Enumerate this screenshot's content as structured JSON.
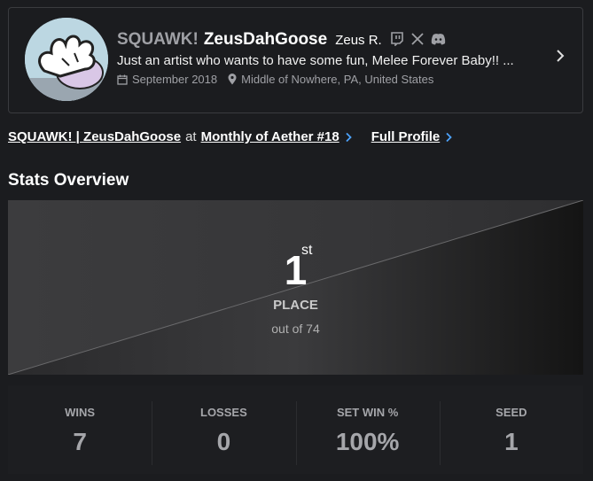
{
  "profile": {
    "prefix": "SQUAWK!",
    "gamertag": "ZeusDahGoose",
    "real_name": "Zeus R.",
    "bio": "Just an artist who wants to have some fun, Melee Forever Baby!! ...",
    "joined": "September 2018",
    "location": "Middle of Nowhere, PA, United States",
    "socials": [
      "twitch-icon",
      "x-icon",
      "discord-icon"
    ]
  },
  "links": {
    "entrant": "SQUAWK! | ZeusDahGoose",
    "at": "at",
    "event": "Monthly of Aether #18",
    "full_profile": "Full Profile"
  },
  "section_title": "Stats Overview",
  "placement": {
    "rank": "1",
    "suffix": "st",
    "label": "PLACE",
    "out_of": "out of 74"
  },
  "stats": [
    {
      "label": "WINS",
      "value": "7"
    },
    {
      "label": "LOSSES",
      "value": "0"
    },
    {
      "label": "SET WIN %",
      "value": "100%"
    },
    {
      "label": "SEED",
      "value": "1"
    }
  ],
  "colors": {
    "background": "#1b1c1f",
    "accent_link": "#4da3ff",
    "muted": "#9fa0a5"
  }
}
